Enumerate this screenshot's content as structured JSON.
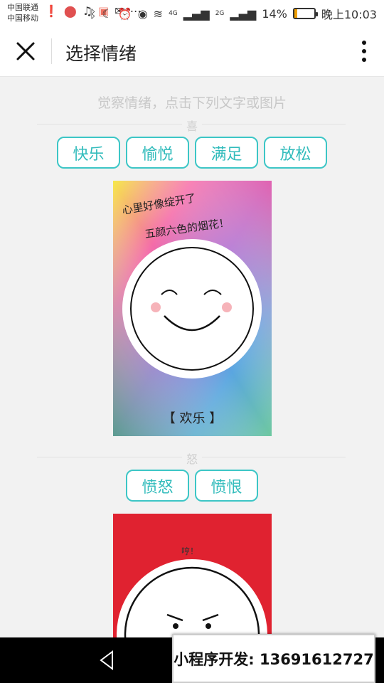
{
  "statusbar": {
    "carrier1": "中国联通",
    "carrier2": "中国移动",
    "network1": "4G",
    "network2": "2G",
    "battery": "14%",
    "time": "晚上10:03",
    "icons": [
      "alert-icon",
      "map-pin-icon",
      "music-app-icon",
      "mail-app-icon",
      "email-icon",
      "more-icon",
      "bluetooth-icon",
      "moon-icon",
      "alarm-icon",
      "eye-icon",
      "wifi-icon",
      "signal-icon",
      "signal-icon",
      "battery-icon"
    ]
  },
  "navbar": {
    "title": "选择情绪"
  },
  "main": {
    "hint": "觉察情绪，点击下列文字或图片",
    "sections": [
      {
        "label": "喜",
        "chips": [
          "快乐",
          "愉悦",
          "满足",
          "放松"
        ],
        "card": {
          "text_line1": "心里好像绽开了",
          "text_line2": "五颜六色的烟花！",
          "caption": "【 欢乐 】"
        }
      },
      {
        "label": "怒",
        "chips": [
          "愤怒",
          "愤恨"
        ],
        "card": {
          "text_line1": "哼！"
        }
      }
    ]
  },
  "footer": {
    "promo": "小程序开发: 13691612727"
  },
  "colors": {
    "accent": "#3cc6c6",
    "background": "#f2f2f2",
    "anger_card": "#e02230"
  }
}
